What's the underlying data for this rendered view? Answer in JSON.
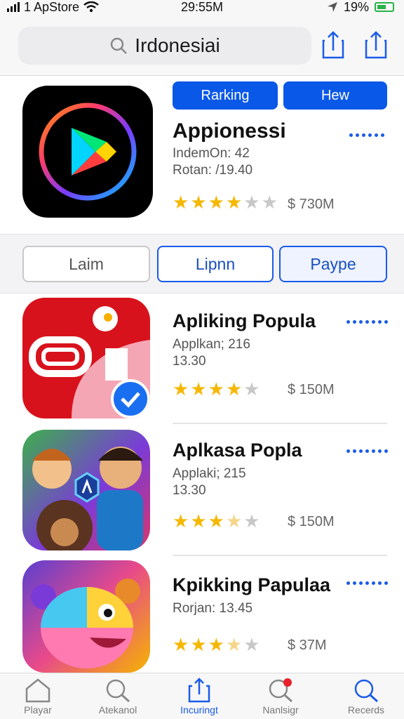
{
  "status_bar": {
    "carrier": "1 ApStore",
    "time": "29:55M",
    "battery": "19%"
  },
  "search": {
    "query": "Irdonesiai"
  },
  "featured": {
    "buttons": [
      "Rarking",
      "Hew"
    ],
    "title": "Appionessi",
    "line1": "IndemOn: 42",
    "line2": "Rotan: /19.40",
    "rating": 3.5,
    "price": "$ 730M"
  },
  "segments": [
    "Laim",
    "Lipnn",
    "Payре"
  ],
  "apps": [
    {
      "title": "Apliking Popula",
      "line1": "Applkan; 216",
      "line2": "13.30",
      "rating": 3.5,
      "price": "$ 150M"
    },
    {
      "title": "Aplkasa Popla",
      "line1": "Applaki; 215",
      "line2": "13.30",
      "rating": 3.5,
      "price": "$ 150M"
    },
    {
      "title": "Kpikking Papulaa",
      "line1": "Rorjan: 13.45",
      "line2": "",
      "rating": 3.5,
      "price": "$ 37M"
    }
  ],
  "tabs": [
    "Playar",
    "Atekanol",
    "Incuringt",
    "Nanlsigr",
    "Recerds"
  ],
  "colors": {
    "accent": "#0a58e8",
    "star": "#f5b800"
  }
}
